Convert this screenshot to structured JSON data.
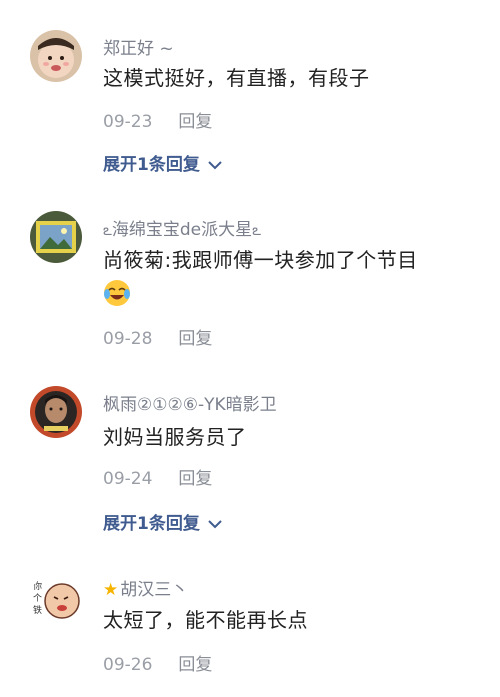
{
  "comments": [
    {
      "username": "郑正好 ~",
      "text": "这模式挺好，有直播，有段子",
      "date": "09-23",
      "reply_label": "回复",
      "expand_label": "展开1条回复",
      "avatar_icon": "baby-face-avatar"
    },
    {
      "username": "海绵宝宝de派大星",
      "username_prefix_icon": "swirl-decoration-icon",
      "username_suffix_icon": "swirl-decoration-icon",
      "text": "尚筱菊:我跟师傅一块参加了个节目",
      "emoji": "laughing-crying-emoji",
      "date": "09-28",
      "reply_label": "回复",
      "avatar_icon": "landscape-photo-avatar"
    },
    {
      "username": "枫雨②①②⑥-YK暗影卫",
      "text": "刘妈当服务员了",
      "date": "09-24",
      "reply_label": "回复",
      "expand_label": "展开1条回复",
      "avatar_icon": "man-portrait-avatar"
    },
    {
      "username": "胡汉三丶",
      "username_prefix_icon": "star-icon",
      "text": "太短了，能不能再长点",
      "date": "09-26",
      "reply_label": "回复",
      "avatar_icon": "cartoon-face-avatar"
    }
  ],
  "colors": {
    "username": "#7a7f8b",
    "text": "#222222",
    "meta": "#9a9ea6",
    "link": "#3f5b8f",
    "star": "#f6b400"
  }
}
